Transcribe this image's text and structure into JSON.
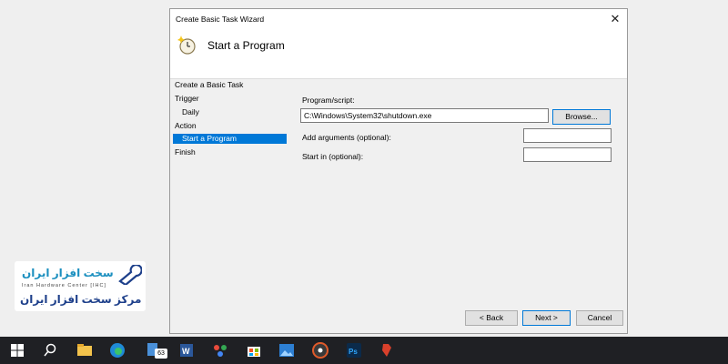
{
  "window": {
    "title": "Create Basic Task Wizard",
    "close_glyph": "✕",
    "header_title": "Start a Program",
    "header_icon": "task-scheduler-icon"
  },
  "nav": {
    "items": [
      {
        "label": "Create a Basic Task",
        "selected": false
      },
      {
        "label": "Trigger",
        "selected": false
      },
      {
        "label": "Daily",
        "selected": false
      },
      {
        "label": "Action",
        "selected": false
      },
      {
        "label": "Start a Program",
        "selected": true
      },
      {
        "label": "Finish",
        "selected": false
      }
    ]
  },
  "form": {
    "program_label": "Program/script:",
    "program_value": "C:\\Windows\\System32\\shutdown.exe",
    "browse_label": "Browse...",
    "args_label": "Add arguments (optional):",
    "args_value": "",
    "startin_label": "Start in (optional):",
    "startin_value": ""
  },
  "buttons": {
    "back": "< Back",
    "next": "Next >",
    "cancel": "Cancel"
  },
  "watermark": {
    "logo_text_top": "سخت افزار ایران",
    "logo_text_en": "Iran Hardware Center [IHC]",
    "logo_text_bottom": "مرکز سخت افزار ایران"
  },
  "taskbar": {
    "icons": [
      "windows-start-icon",
      "search-icon",
      "file-explorer-icon",
      "edge-browser-icon",
      "app-icon",
      "word-icon",
      "apps-launcher-icon",
      "microsoft-store-icon",
      "photos-icon",
      "media-player-icon",
      "photoshop-icon",
      "pdf-reader-icon"
    ],
    "badge_count": "63",
    "accent": "#0078d7"
  }
}
